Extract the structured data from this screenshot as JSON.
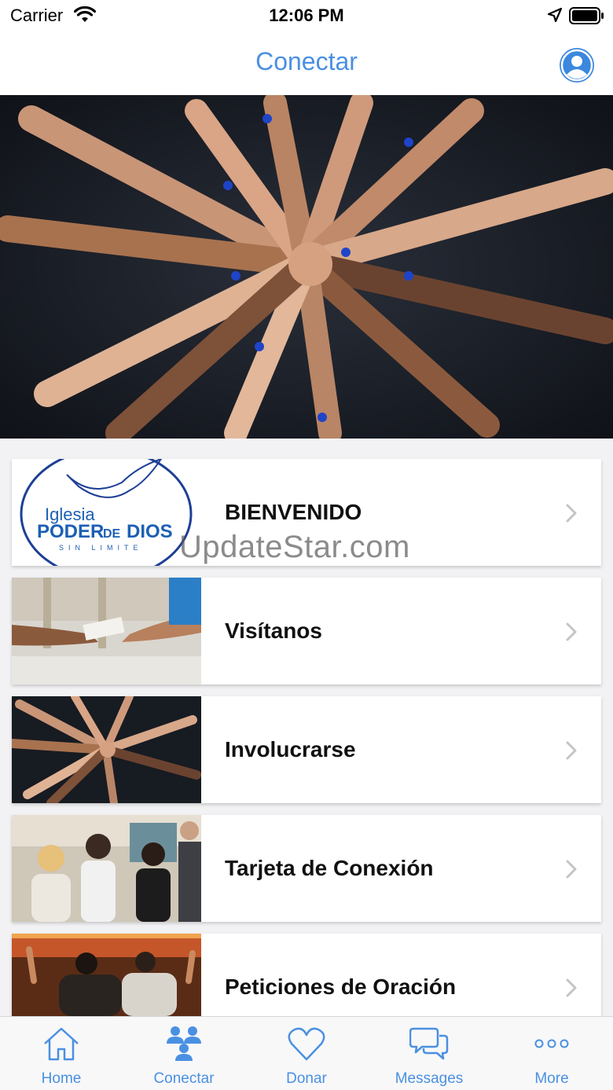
{
  "status_bar": {
    "carrier": "Carrier",
    "time": "12:06 PM"
  },
  "nav": {
    "title": "Conectar",
    "accent_color": "#4a90e2"
  },
  "list": {
    "items": [
      {
        "label": "BIENVENIDO",
        "logo": {
          "line1": "Iglesia",
          "line2a": "PODER",
          "line2b": "DE",
          "line2c": "DIOS",
          "line3": "SIN LIMITE"
        }
      },
      {
        "label": "Visítanos"
      },
      {
        "label": "Involucrarse"
      },
      {
        "label": "Tarjeta de Conexión"
      },
      {
        "label": "Peticiones de Oración"
      }
    ]
  },
  "watermark": "UpdateStar.com",
  "tabs": [
    {
      "label": "Home",
      "icon": "home-icon"
    },
    {
      "label": "Conectar",
      "icon": "people-icon"
    },
    {
      "label": "Donar",
      "icon": "heart-icon"
    },
    {
      "label": "Messages",
      "icon": "chat-icon"
    },
    {
      "label": "More",
      "icon": "more-icon"
    }
  ]
}
